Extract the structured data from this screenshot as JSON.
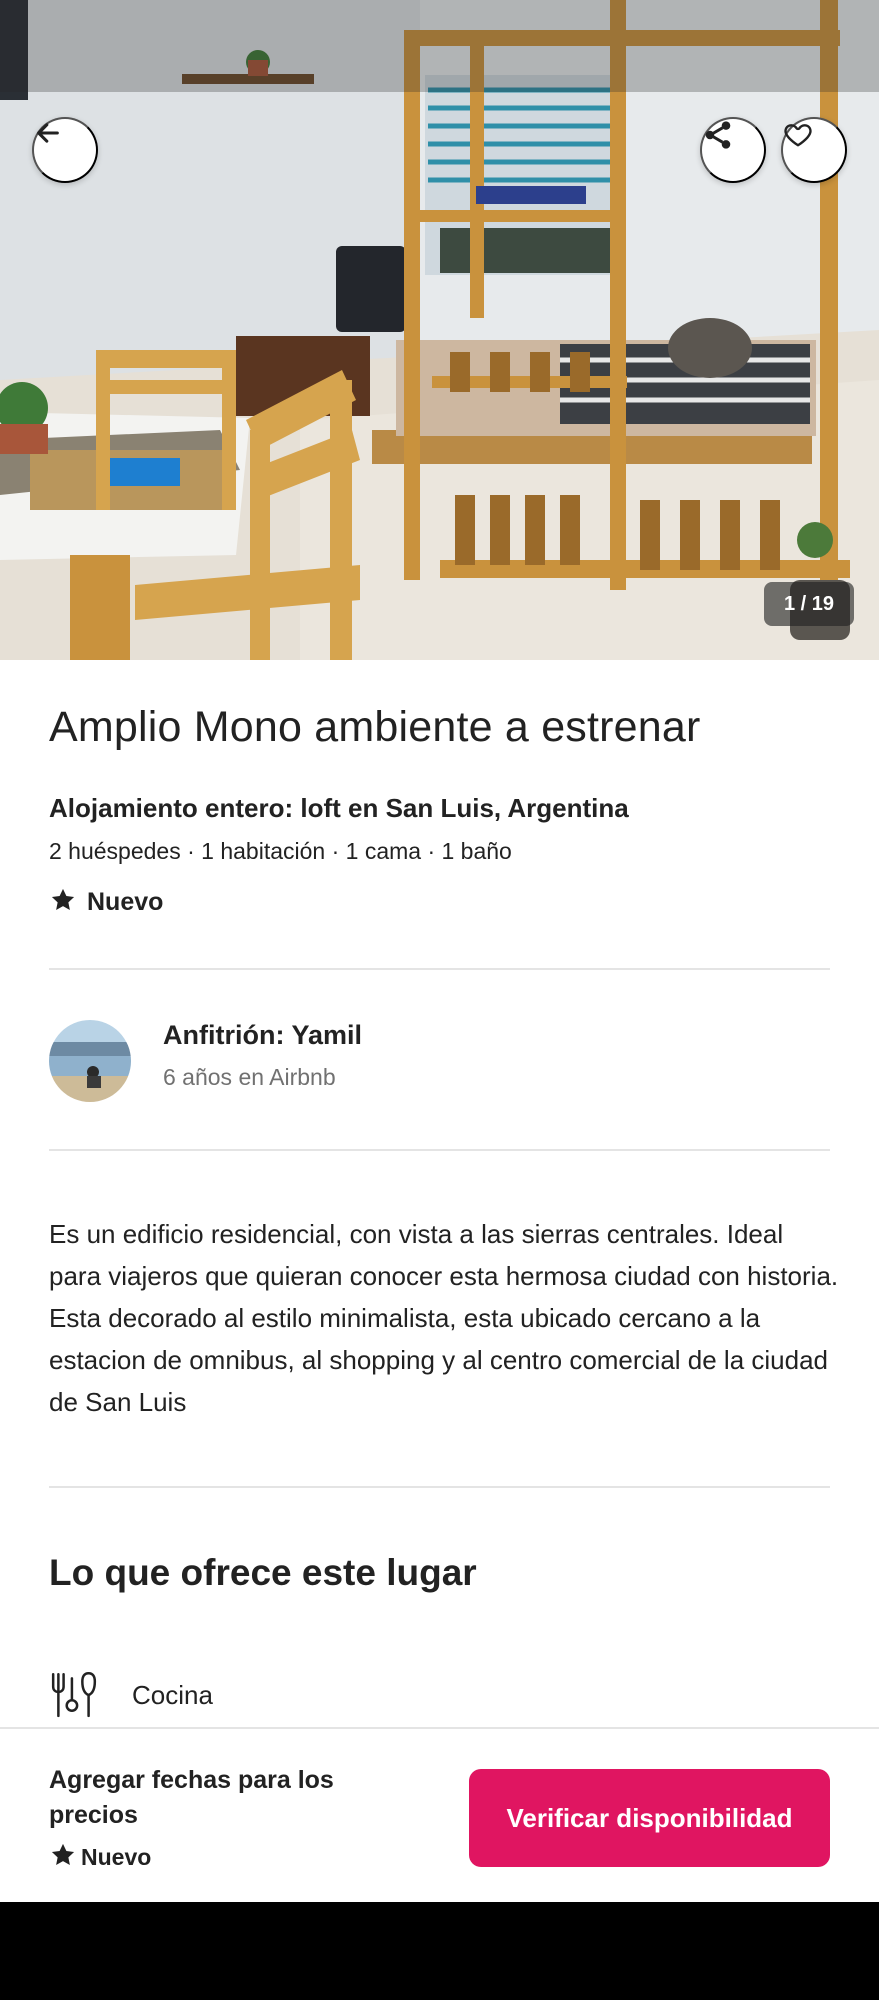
{
  "hero": {
    "photo_counter": "1 / 19",
    "icons": {
      "back": "arrow-left-icon",
      "share": "share-icon",
      "favorite": "heart-icon"
    }
  },
  "listing": {
    "title": "Amplio Mono ambiente a estrenar",
    "subtitle": "Alojamiento entero: loft en San Luis, Argentina",
    "details": "2 huéspedes · 1 habitación · 1 cama · 1 baño",
    "rating_label": "Nuevo"
  },
  "host": {
    "name": "Anfitrión: Yamil",
    "tenure": "6 años en Airbnb"
  },
  "description": "Es un edificio residencial, con vista a las sierras centrales. Ideal para viajeros que quieran conocer esta hermosa ciudad con historia. Esta decorado al estilo minimalista, esta ubicado cercano a la estacion de omnibus, al shopping y al centro comercial de la ciudad de San Luis",
  "amenities": {
    "title": "Lo que ofrece este lugar",
    "items": [
      {
        "label": "Cocina",
        "icon": "kitchen-utensils-icon"
      }
    ]
  },
  "bottom_bar": {
    "price_note": "Agregar fechas para los precios",
    "rating_label": "Nuevo",
    "cta_label": "Verificar disponibilidad"
  },
  "colors": {
    "brand": "#E01561",
    "text_primary": "#222222",
    "text_secondary": "#717171",
    "divider": "#E4E4E4"
  }
}
